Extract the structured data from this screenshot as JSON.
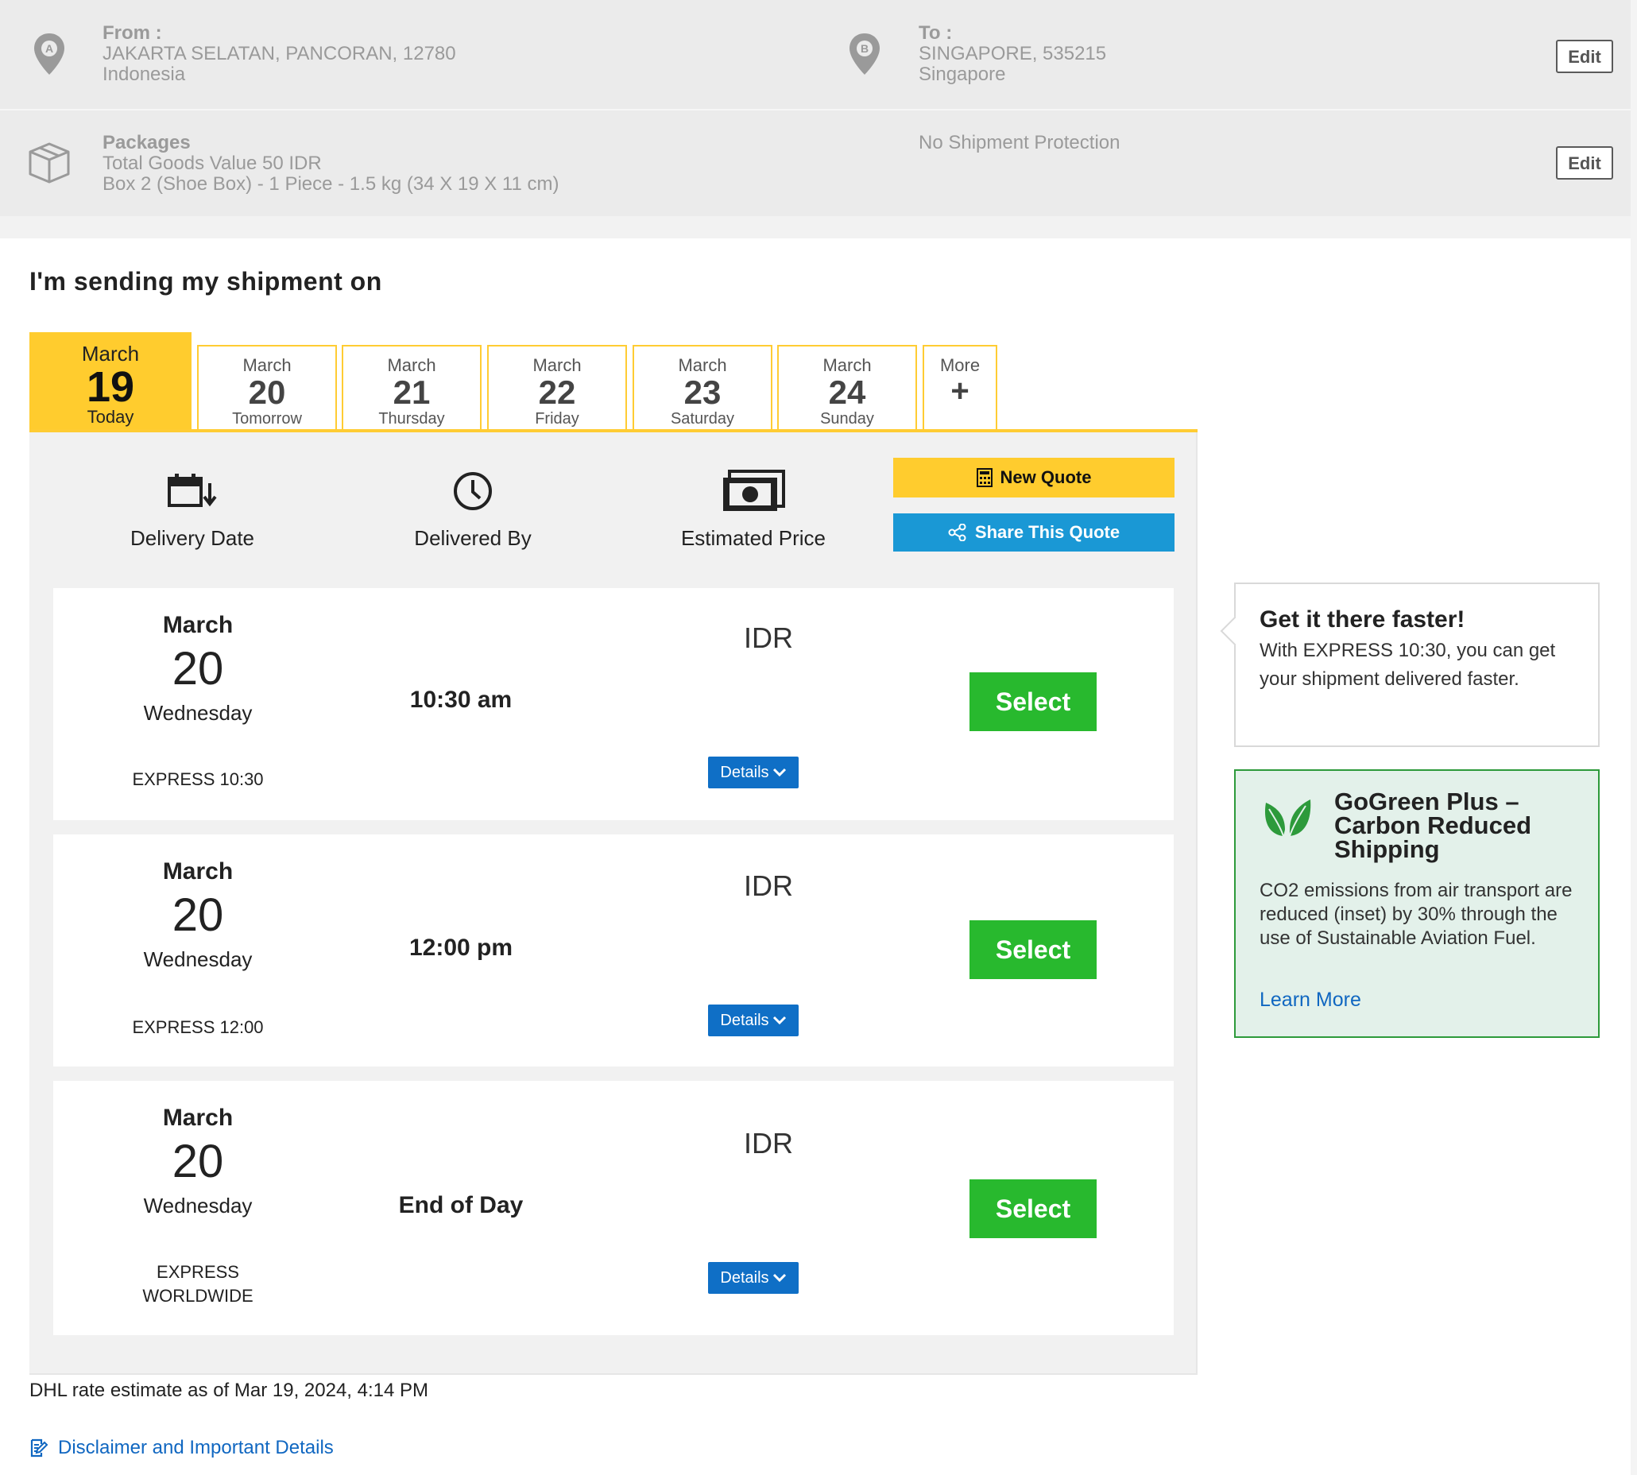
{
  "summary": {
    "from_label": "From :",
    "from_address": "JAKARTA SELATAN, PANCORAN, 12780",
    "from_country": "Indonesia",
    "to_label": "To :",
    "to_address": "SINGAPORE, 535215",
    "to_country": "Singapore",
    "packages_label": "Packages",
    "goods_value": "Total Goods Value 50 IDR",
    "package_detail": "Box 2 (Shoe Box) - 1 Piece - 1.5 kg (34 X 19 X 11 cm)",
    "protection": "No Shipment Protection",
    "edit_label": "Edit",
    "pin_a": "A",
    "pin_b": "B"
  },
  "heading": "I'm sending my shipment on",
  "date_tabs": [
    {
      "month": "March",
      "day": "19",
      "weekday": "Today",
      "active": true
    },
    {
      "month": "March",
      "day": "20",
      "weekday": "Tomorrow"
    },
    {
      "month": "March",
      "day": "21",
      "weekday": "Thursday"
    },
    {
      "month": "March",
      "day": "22",
      "weekday": "Friday"
    },
    {
      "month": "March",
      "day": "23",
      "weekday": "Saturday"
    },
    {
      "month": "March",
      "day": "24",
      "weekday": "Sunday"
    }
  ],
  "more_tab": {
    "label": "More",
    "plus": "+"
  },
  "columns": {
    "delivery_date": "Delivery Date",
    "delivered_by": "Delivered By",
    "estimated_price": "Estimated Price"
  },
  "actions": {
    "new_quote": "New Quote",
    "share_quote": "Share This Quote"
  },
  "options": [
    {
      "month": "March",
      "day": "20",
      "weekday": "Wednesday",
      "product_line1": "EXPRESS 10:30",
      "product_line2": "",
      "delivered_by": "10:30 am",
      "currency": "IDR",
      "details": "Details",
      "select": "Select"
    },
    {
      "month": "March",
      "day": "20",
      "weekday": "Wednesday",
      "product_line1": "EXPRESS 12:00",
      "product_line2": "",
      "delivered_by": "12:00 pm",
      "currency": "IDR",
      "details": "Details",
      "select": "Select"
    },
    {
      "month": "March",
      "day": "20",
      "weekday": "Wednesday",
      "product_line1": "EXPRESS",
      "product_line2": "WORLDWIDE",
      "delivered_by": "End of Day",
      "currency": "IDR",
      "details": "Details",
      "select": "Select"
    }
  ],
  "estimate_note": "DHL rate estimate as of Mar 19, 2024, 4:14 PM",
  "disclaimer_link": "Disclaimer and Important Details",
  "promo": {
    "title": "Get it there faster!",
    "body": "With EXPRESS 10:30, you can get your shipment delivered faster."
  },
  "gogreen": {
    "title": "GoGreen Plus – Carbon Reduced Shipping",
    "body": "CO2 emissions from air transport are reduced (inset) by 30% through the use of Sustainable Aviation Fuel.",
    "link": "Learn More"
  },
  "colors": {
    "dhl_yellow": "#ffcc2e",
    "share_blue": "#1a98d5",
    "details_blue": "#0f6fc6",
    "select_green": "#28b92e",
    "link_blue": "#1067c1",
    "green_border": "#2d9a3b"
  },
  "icons": [
    "location-pin-icon",
    "package-box-icon",
    "calendar-icon",
    "clock-icon",
    "money-icon",
    "calculator-icon",
    "share-icon",
    "chevron-down-icon",
    "leaf-icon",
    "edit-document-icon"
  ]
}
